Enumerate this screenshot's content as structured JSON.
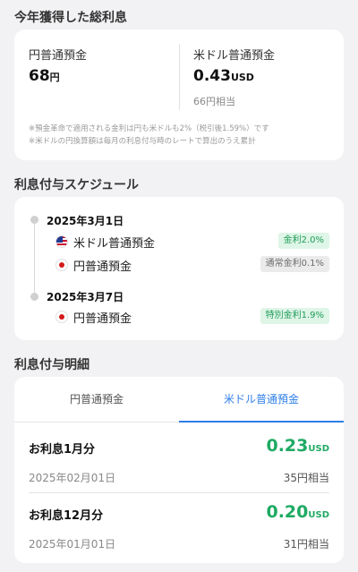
{
  "total": {
    "section_title": "今年獲得した総利息",
    "jpy": {
      "label": "円普通預金",
      "amount": "68",
      "unit": "円"
    },
    "usd": {
      "label": "米ドル普通預金",
      "amount": "0.43",
      "unit": "USD",
      "approx": "66円相当"
    },
    "notes": [
      "※預金革命で適用される金利は円も米ドルも2%（税引後1.59%）です",
      "※米ドルの円換算額は毎月の利息付与時のレートで算出のうえ累計"
    ]
  },
  "schedule": {
    "section_title": "利息付与スケジュール",
    "entries": [
      {
        "date": "2025年3月1日",
        "accounts": [
          {
            "flag": "us-flag-icon",
            "name": "米ドル普通預金",
            "badge": "金利2.0%",
            "badge_style": "green"
          },
          {
            "flag": "jp-flag-icon",
            "name": "円普通預金",
            "badge": "通常金利0.1%",
            "badge_style": "gray"
          }
        ]
      },
      {
        "date": "2025年3月7日",
        "accounts": [
          {
            "flag": "jp-flag-icon",
            "name": "円普通預金",
            "badge": "特別金利1.9%",
            "badge_style": "green"
          }
        ]
      }
    ]
  },
  "details": {
    "section_title": "利息付与明細",
    "tabs": [
      {
        "label": "円普通預金",
        "active": false
      },
      {
        "label": "米ドル普通預金",
        "active": true
      }
    ],
    "rows": [
      {
        "title": "お利息1月分",
        "amount": "0.23",
        "unit": "USD",
        "date": "2025年02月01日",
        "approx": "35円相当"
      },
      {
        "title": "お利息12月分",
        "amount": "0.20",
        "unit": "USD",
        "date": "2025年01月01日",
        "approx": "31円相当"
      }
    ]
  },
  "colors": {
    "background": "#f2f2f4",
    "accent_blue": "#2f7fe8",
    "positive_green": "#1faa63",
    "badge_green_bg": "#def5e7",
    "badge_gray_bg": "#ebebeb"
  }
}
